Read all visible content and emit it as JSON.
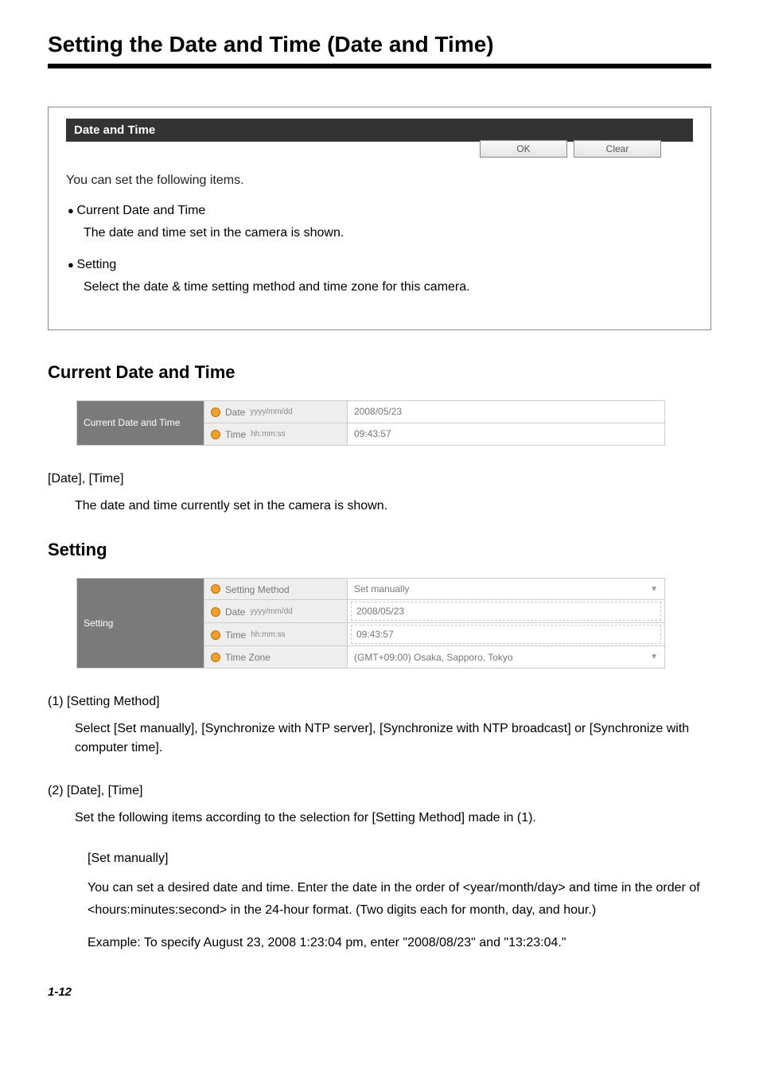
{
  "page": {
    "title": "Setting the Date and Time (Date and Time)",
    "number": "1-12"
  },
  "box": {
    "header": "Date and Time",
    "buttons": {
      "ok": "OK",
      "clear": "Clear"
    },
    "intro": "You can set the following items.",
    "items": [
      {
        "title": "Current Date and Time",
        "desc": "The date and time set in the camera is shown."
      },
      {
        "title": "Setting",
        "desc": "Select the date & time setting method and time zone for this camera."
      }
    ]
  },
  "current": {
    "heading": "Current Date and Time",
    "table": {
      "rowhead": "Current Date and Time",
      "rows": [
        {
          "label": "Date",
          "hint": "yyyy/mm/dd",
          "value": "2008/05/23"
        },
        {
          "label": "Time",
          "hint": "hh:mm:ss",
          "value": "09:43:57"
        }
      ]
    },
    "datetime_label": "[Date], [Time]",
    "datetime_desc": "The date and time currently set in the camera is shown."
  },
  "setting": {
    "heading": "Setting",
    "table": {
      "rowhead": "Setting",
      "rows": [
        {
          "label": "Setting Method",
          "hint": "",
          "value": "Set manually",
          "dropdown": true
        },
        {
          "label": "Date",
          "hint": "yyyy/mm/dd",
          "value": "2008/05/23",
          "input": true
        },
        {
          "label": "Time",
          "hint": "hh:mm:ss",
          "value": "09:43:57",
          "input": true
        },
        {
          "label": "Time Zone",
          "hint": "",
          "value": "(GMT+09:00) Osaka, Sapporo, Tokyo",
          "dropdown": true
        }
      ]
    },
    "item1": {
      "num": "(1)",
      "title": "[Setting Method]",
      "desc_pre": "Select [",
      "opt1": "Set manually",
      "mid1": "], [",
      "opt2": "Synchronize with NTP server",
      "mid2": "], [",
      "opt3": "Synchronize with NTP broadcast",
      "mid3": "] or [",
      "opt4": "Synchronize with computer time",
      "desc_post": "]."
    },
    "item2": {
      "num": "(2)",
      "title": "[Date], [Time]",
      "desc_a": "Set the following items according to the selection for [",
      "desc_b": "Setting Method",
      "desc_c": "] made in (1).",
      "sub_title": "[Set manually]",
      "sub_p1": "You can set a desired date and time. Enter the date in the order of <year/month/day> and time in the order of <hours:minutes:second> in the 24-hour format. (Two digits each for month, day, and hour.)",
      "sub_p2": "Example: To specify August 23, 2008 1:23:04 pm, enter \"2008/08/23\" and \"13:23:04.\""
    }
  }
}
